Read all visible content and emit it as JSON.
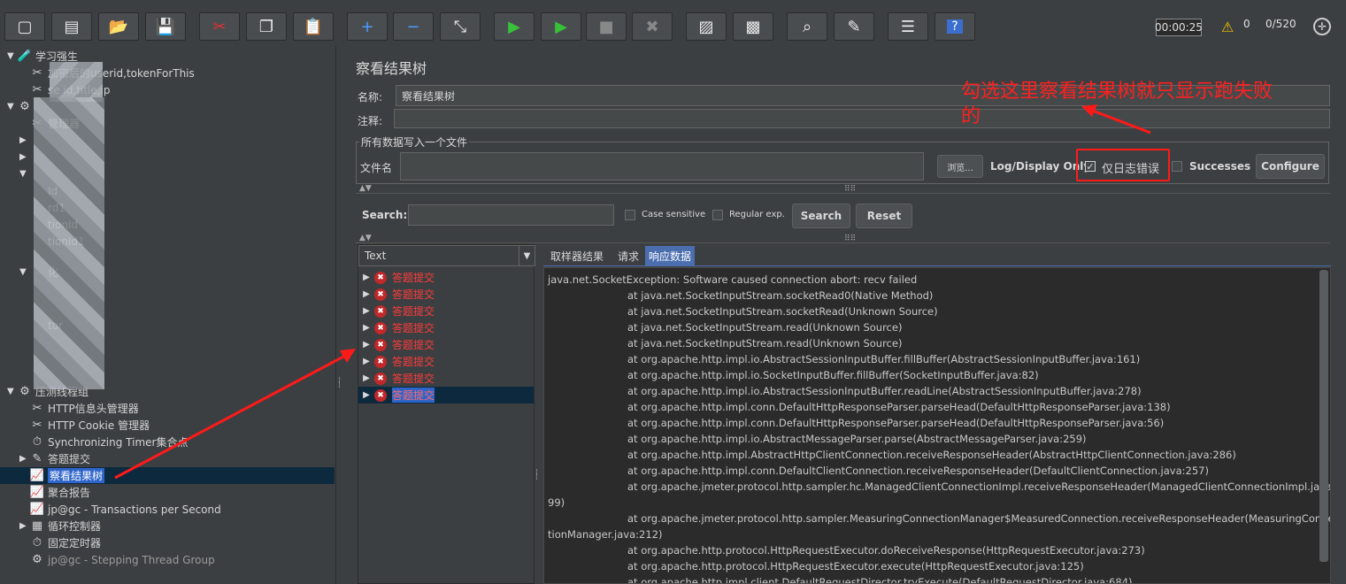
{
  "toolbar": {
    "buttons": [
      "new-icon",
      "templates-icon",
      "open-icon",
      "save-icon",
      "cut-icon",
      "copy-icon",
      "paste-icon",
      "expand-icon",
      "collapse-icon",
      "toggle-icon",
      "start-icon",
      "start-no-pause-icon",
      "stop-icon",
      "shutdown-icon",
      "clear-icon",
      "clear-all-icon",
      "search-icon",
      "reset-search-icon",
      "function-helper-icon",
      "help-icon"
    ],
    "elapsed": "00:00:25",
    "warnings": "0",
    "threads": "0/520"
  },
  "tree": {
    "items": [
      {
        "label": "学习强生",
        "toggle": "▼",
        "icon": "🧪"
      },
      {
        "label": "加密后的userid,tokenForThis",
        "toggle": "",
        "icon": "✂"
      },
      {
        "label": "se         id,title,ip",
        "toggle": "",
        "icon": "✂"
      },
      {
        "label": "",
        "toggle": "▼",
        "icon": "⚙"
      },
      {
        "label": "管理器",
        "toggle": "",
        "icon": "✂"
      },
      {
        "label": "",
        "toggle": "▶",
        "icon": ""
      },
      {
        "label": "",
        "toggle": "▶",
        "icon": ""
      },
      {
        "label": "",
        "toggle": "▼",
        "icon": ""
      },
      {
        "label": "Id",
        "toggle": "",
        "icon": ""
      },
      {
        "label": "rd1",
        "toggle": "",
        "icon": ""
      },
      {
        "label": "tionId",
        "toggle": "",
        "icon": ""
      },
      {
        "label": "tionId1",
        "toggle": "",
        "icon": ""
      },
      {
        "label": "化",
        "toggle": "▼",
        "icon": ""
      },
      {
        "label": "tor",
        "toggle": "",
        "icon": ""
      },
      {
        "label": "压测线程组",
        "toggle": "▼",
        "icon": "⚙"
      },
      {
        "label": "HTTP信息头管理器",
        "toggle": "",
        "icon": "✂"
      },
      {
        "label": "HTTP Cookie 管理器",
        "toggle": "",
        "icon": "✂"
      },
      {
        "label": "Synchronizing Timer集合点",
        "toggle": "",
        "icon": "⏱"
      },
      {
        "label": "答题提交",
        "toggle": "▶",
        "icon": "✎"
      },
      {
        "label": "察看结果树",
        "toggle": "",
        "icon": "📈"
      },
      {
        "label": "聚合报告",
        "toggle": "",
        "icon": "📈"
      },
      {
        "label": "jp@gc - Transactions per Second",
        "toggle": "",
        "icon": "📈"
      },
      {
        "label": "循环控制器",
        "toggle": "▶",
        "icon": "▦"
      },
      {
        "label": "固定定时器",
        "toggle": "",
        "icon": "⏱"
      },
      {
        "label": "jp@gc - Stepping Thread Group",
        "toggle": "",
        "icon": "⚙"
      }
    ]
  },
  "panel": {
    "title": "察看结果树",
    "name_label": "名称:",
    "name_value": "察看结果树",
    "comment_label": "注释:",
    "file_section": "所有数据写入一个文件",
    "filename_label": "文件名",
    "browse": "浏览...",
    "log_display": "Log/Display Only:",
    "errors_only": "仅日志错误",
    "successes": "Successes",
    "configure": "Configure",
    "search_label": "Search:",
    "case_sensitive": "Case sensitive",
    "regular_exp": "Regular exp.",
    "search_btn": "Search",
    "reset_btn": "Reset",
    "renderer": "Text",
    "tabs": [
      "取样器结果",
      "请求",
      "响应数据"
    ],
    "result_items": [
      "答题提交",
      "答题提交",
      "答题提交",
      "答题提交",
      "答题提交",
      "答题提交",
      "答题提交",
      "答题提交"
    ]
  },
  "response": {
    "lines": [
      {
        "t": "java.net.SocketException: Software caused connection abort: recv failed",
        "ind": false
      },
      {
        "t": "at java.net.SocketInputStream.socketRead0(Native Method)",
        "ind": true
      },
      {
        "t": "at java.net.SocketInputStream.socketRead(Unknown Source)",
        "ind": true
      },
      {
        "t": "at java.net.SocketInputStream.read(Unknown Source)",
        "ind": true
      },
      {
        "t": "at java.net.SocketInputStream.read(Unknown Source)",
        "ind": true
      },
      {
        "t": "at org.apache.http.impl.io.AbstractSessionInputBuffer.fillBuffer(AbstractSessionInputBuffer.java:161)",
        "ind": true
      },
      {
        "t": "at org.apache.http.impl.io.SocketInputBuffer.fillBuffer(SocketInputBuffer.java:82)",
        "ind": true
      },
      {
        "t": "at org.apache.http.impl.io.AbstractSessionInputBuffer.readLine(AbstractSessionInputBuffer.java:278)",
        "ind": true
      },
      {
        "t": "at org.apache.http.impl.conn.DefaultHttpResponseParser.parseHead(DefaultHttpResponseParser.java:138)",
        "ind": true
      },
      {
        "t": "at org.apache.http.impl.conn.DefaultHttpResponseParser.parseHead(DefaultHttpResponseParser.java:56)",
        "ind": true
      },
      {
        "t": "at org.apache.http.impl.io.AbstractMessageParser.parse(AbstractMessageParser.java:259)",
        "ind": true
      },
      {
        "t": "at org.apache.http.impl.AbstractHttpClientConnection.receiveResponseHeader(AbstractHttpClientConnection.java:286)",
        "ind": true
      },
      {
        "t": "at org.apache.http.impl.conn.DefaultClientConnection.receiveResponseHeader(DefaultClientConnection.java:257)",
        "ind": true
      },
      {
        "t": "at org.apache.jmeter.protocol.http.sampler.hc.ManagedClientConnectionImpl.receiveResponseHeader(ManagedClientConnectionImpl.java:1",
        "ind": true
      },
      {
        "t": "99)",
        "ind": false
      },
      {
        "t": "at org.apache.jmeter.protocol.http.sampler.MeasuringConnectionManager$MeasuredConnection.receiveResponseHeader(MeasuringConnec",
        "ind": true
      },
      {
        "t": "tionManager.java:212)",
        "ind": false
      },
      {
        "t": "at org.apache.http.protocol.HttpRequestExecutor.doReceiveResponse(HttpRequestExecutor.java:273)",
        "ind": true
      },
      {
        "t": "at org.apache.http.protocol.HttpRequestExecutor.execute(HttpRequestExecutor.java:125)",
        "ind": true
      },
      {
        "t": "at org.apache.http.impl.client.DefaultRequestDirector.tryExecute(DefaultRequestDirector.java:684)",
        "ind": true
      }
    ]
  },
  "annotation": {
    "text": "勾选这里察看结果树就只显示跑失败的",
    "color": "#ff2020"
  },
  "colors": {
    "background": "#3c3f41",
    "selection": "#2f65ca",
    "error_text": "#ff3b3b"
  }
}
